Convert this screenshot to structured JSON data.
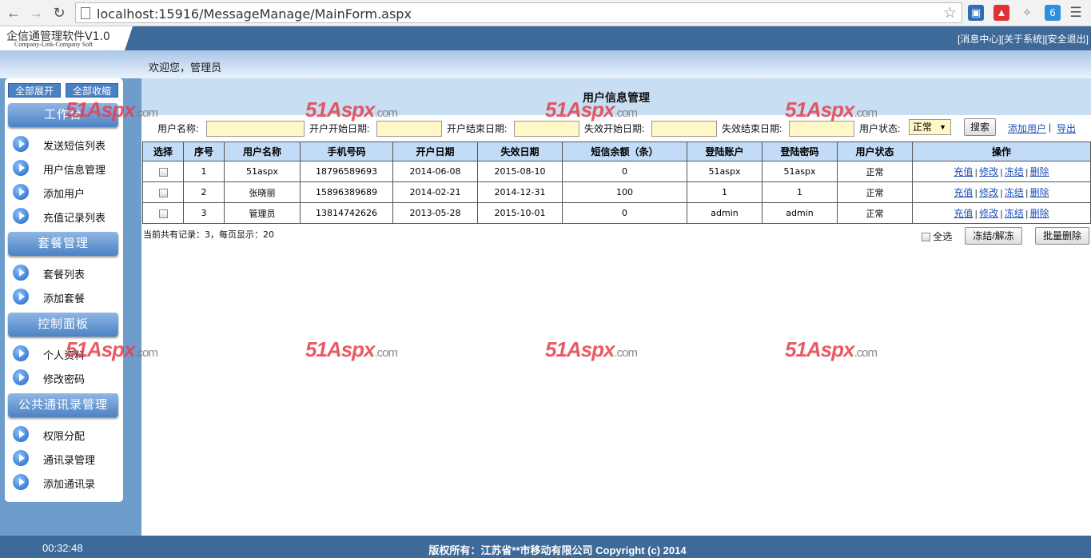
{
  "browser": {
    "url": "localhost:15916/MessageManage/MainForm.aspx"
  },
  "header": {
    "app_title": "企信通管理软件V1.0",
    "app_subtitle": "Company-Link-Company Soft",
    "links": [
      "[消息中心]",
      "[关于系统]",
      "[安全退出]"
    ],
    "welcome": "欢迎您，管理员"
  },
  "sidebar": {
    "expand_all": "全部展开",
    "collapse_all": "全部收缩",
    "groups": [
      {
        "title": "工作台",
        "items": [
          "发送短信列表",
          "用户信息管理",
          "添加用户",
          "充值记录列表"
        ]
      },
      {
        "title": "套餐管理",
        "items": [
          "套餐列表",
          "添加套餐"
        ]
      },
      {
        "title": "控制面板",
        "items": [
          "个人资料",
          "修改密码"
        ]
      },
      {
        "title": "公共通讯录管理",
        "items": [
          "权限分配",
          "通讯录管理",
          "添加通讯录"
        ]
      }
    ]
  },
  "main": {
    "title": "用户信息管理",
    "filters": {
      "username_label": "用户名称:",
      "open_start_label": "开户开始日期:",
      "open_end_label": "开户结束日期:",
      "expire_start_label": "失效开始日期:",
      "expire_end_label": "失效结束日期:",
      "status_label": "用户状态:",
      "status_value": "正常",
      "search_button": "搜索",
      "add_user_link": "添加用户",
      "export_link": "导出"
    },
    "table": {
      "columns": [
        "选择",
        "序号",
        "用户名称",
        "手机号码",
        "开户日期",
        "失效日期",
        "短信余额（条）",
        "登陆账户",
        "登陆密码",
        "用户状态",
        "操作"
      ],
      "rows": [
        {
          "no": "1",
          "name": "51aspx",
          "phone": "18796589693",
          "open": "2014-06-08",
          "expire": "2015-08-10",
          "balance": "0",
          "account": "51aspx",
          "password": "51aspx",
          "status": "正常"
        },
        {
          "no": "2",
          "name": "张晓丽",
          "phone": "15896389689",
          "open": "2014-02-21",
          "expire": "2014-12-31",
          "balance": "100",
          "account": "1",
          "password": "1",
          "status": "正常"
        },
        {
          "no": "3",
          "name": "管理员",
          "phone": "13814742626",
          "open": "2013-05-28",
          "expire": "2015-10-01",
          "balance": "0",
          "account": "admin",
          "password": "admin",
          "status": "正常"
        }
      ],
      "actions": [
        "充值",
        "修改",
        "冻结",
        "删除"
      ]
    },
    "summary": "当前共有记录：3，每页显示：20",
    "select_all": "全选",
    "freeze_button": "冻结/解冻",
    "batch_delete_button": "批量删除"
  },
  "watermark": {
    "main": "51Aspx",
    "suffix": ".com"
  },
  "footer": {
    "time": "00:32:48",
    "copyright": "版权所有：江苏省**市移动有限公司 Copyright (c) 2014"
  }
}
